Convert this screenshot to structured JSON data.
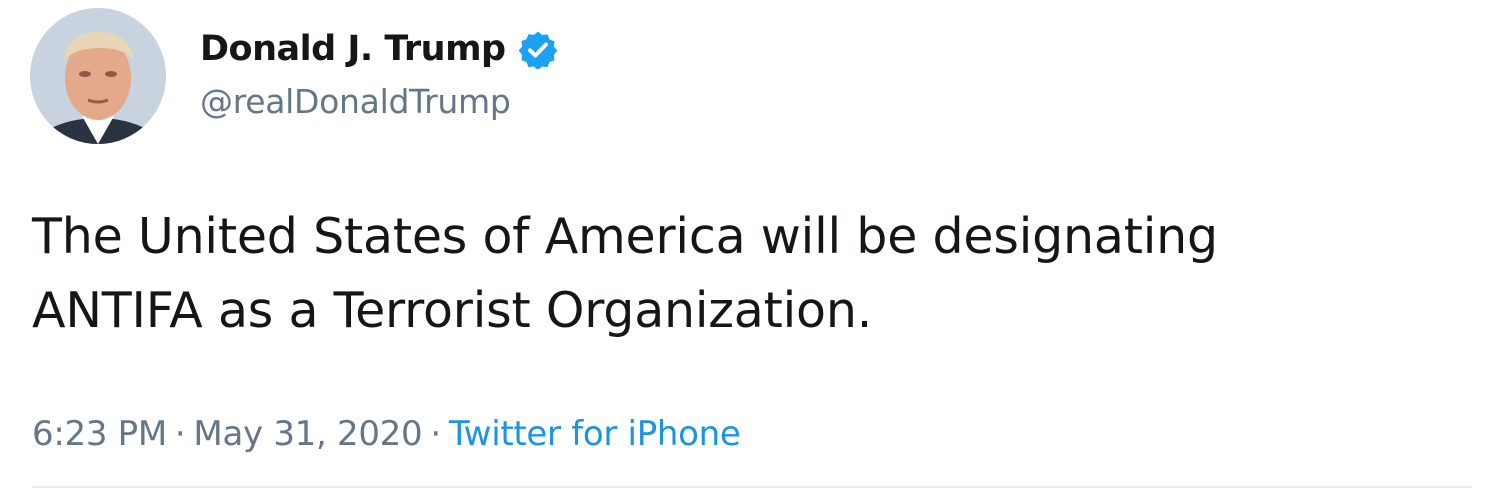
{
  "user": {
    "display_name": "Donald J. Trump",
    "handle": "@realDonaldTrump",
    "verified": true,
    "avatar_icon": "profile-photo"
  },
  "tweet": {
    "line1": "The United States of America will be designating",
    "line2": "ANTIFA as a Terrorist Organization."
  },
  "meta": {
    "time": "6:23 PM",
    "separator": "·",
    "date": "May 31, 2020",
    "source": "Twitter for iPhone"
  },
  "colors": {
    "text": "#14171a",
    "secondary": "#657786",
    "link": "#1b95e0",
    "verified_badge": "#1da1f2",
    "divider": "#e6ecf0"
  }
}
